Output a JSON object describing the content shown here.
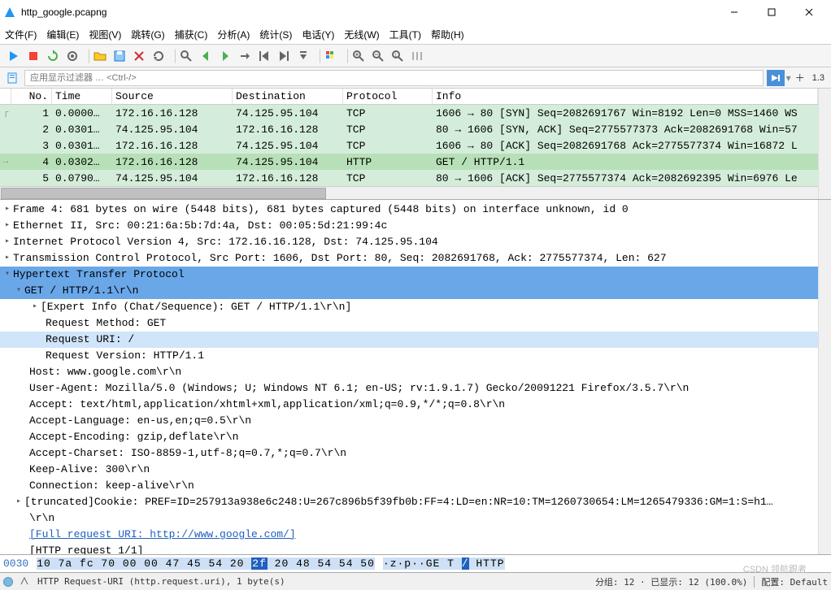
{
  "title": "http_google.pcapng",
  "menu": [
    "文件(F)",
    "编辑(E)",
    "视图(V)",
    "跳转(G)",
    "捕获(C)",
    "分析(A)",
    "统计(S)",
    "电话(Y)",
    "无线(W)",
    "工具(T)",
    "帮助(H)"
  ],
  "filter_placeholder": "应用显示过滤器 … <Ctrl-/>",
  "version_label": "1.3",
  "columns": [
    "No.",
    "Time",
    "Source",
    "Destination",
    "Protocol",
    "Info"
  ],
  "packets": [
    {
      "no": "1",
      "time": "0.0000…",
      "src": "172.16.16.128",
      "dst": "74.125.95.104",
      "proto": "TCP",
      "info": "1606 → 80 [SYN] Seq=2082691767 Win=8192 Len=0 MSS=1460 WS",
      "cls": "syn",
      "arrow": "┌"
    },
    {
      "no": "2",
      "time": "0.0301…",
      "src": "74.125.95.104",
      "dst": "172.16.16.128",
      "proto": "TCP",
      "info": "80 → 1606 [SYN, ACK] Seq=2775577373 Ack=2082691768 Win=57",
      "cls": "syn",
      "arrow": ""
    },
    {
      "no": "3",
      "time": "0.0301…",
      "src": "172.16.16.128",
      "dst": "74.125.95.104",
      "proto": "TCP",
      "info": "1606 → 80 [ACK] Seq=2082691768 Ack=2775577374 Win=16872 L",
      "cls": "syn",
      "arrow": ""
    },
    {
      "no": "4",
      "time": "0.0302…",
      "src": "172.16.16.128",
      "dst": "74.125.95.104",
      "proto": "HTTP",
      "info": "GET / HTTP/1.1",
      "cls": "http",
      "arrow": "→"
    },
    {
      "no": "5",
      "time": "0.0790…",
      "src": "74.125.95.104",
      "dst": "172.16.16.128",
      "proto": "TCP",
      "info": "80 → 1606 [ACK] Seq=2775577374 Ack=2082692395 Win=6976 Le",
      "cls": "syn",
      "arrow": ""
    }
  ],
  "tree": {
    "frame": "Frame 4: 681 bytes on wire (5448 bits), 681 bytes captured (5448 bits) on interface unknown, id 0",
    "eth": "Ethernet II, Src: 00:21:6a:5b:7d:4a, Dst: 00:05:5d:21:99:4c",
    "ip": "Internet Protocol Version 4, Src: 172.16.16.128, Dst: 74.125.95.104",
    "tcp": "Transmission Control Protocol, Src Port: 1606, Dst Port: 80, Seq: 2082691768, Ack: 2775577374, Len: 627",
    "http_title": "Hypertext Transfer Protocol",
    "get_line": "GET / HTTP/1.1\\r\\n",
    "expert": "[Expert Info (Chat/Sequence): GET / HTTP/1.1\\r\\n]",
    "method": "Request Method: GET",
    "uri": "Request URI: /",
    "version": "Request Version: HTTP/1.1",
    "host": "Host: www.google.com\\r\\n",
    "ua": "User-Agent: Mozilla/5.0 (Windows; U; Windows NT 6.1; en-US; rv:1.9.1.7) Gecko/20091221 Firefox/3.5.7\\r\\n",
    "accept": "Accept: text/html,application/xhtml+xml,application/xml;q=0.9,*/*;q=0.8\\r\\n",
    "alang": "Accept-Language: en-us,en;q=0.5\\r\\n",
    "aenc": "Accept-Encoding: gzip,deflate\\r\\n",
    "achar": "Accept-Charset: ISO-8859-1,utf-8;q=0.7,*;q=0.7\\r\\n",
    "keep": "Keep-Alive: 300\\r\\n",
    "conn": "Connection: keep-alive\\r\\n",
    "cookie": "[truncated]Cookie: PREF=ID=257913a938e6c248:U=267c896b5f39fb0b:FF=4:LD=en:NR=10:TM=1260730654:LM=1265479336:GM=1:S=h1…",
    "crlf": "\\r\\n",
    "full_uri": "[Full request URI: http://www.google.com/]",
    "req_11": "[HTTP request 1/1]"
  },
  "hex": {
    "offset": "0030",
    "pre": "10 7a fc 70 00 00 47 45  54 20 ",
    "sel": "2f",
    "post": " 20 48 54 54 50",
    "ascii_pre": "·z·p··GE T ",
    "ascii_sel": "/",
    "ascii_post": " HTTP"
  },
  "status": {
    "field": "HTTP Request-URI (http.request.uri), 1 byte(s)",
    "pkts": "分组: 12 · 已显示: 12 (100.0%)",
    "profile": "配置: Default"
  },
  "watermark": "CSDN 领航跟者"
}
